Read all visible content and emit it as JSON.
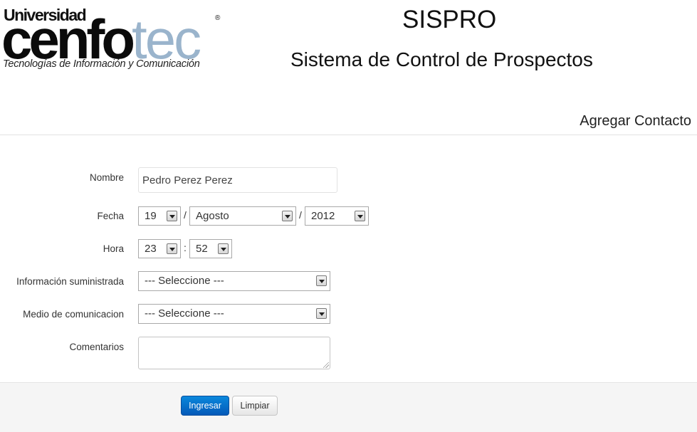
{
  "header": {
    "logo": {
      "top_text": "Universidad",
      "word_part1": "cenfo",
      "word_part2": "tec",
      "registered": "®",
      "tagline": "Tecnologías de Información y Comunicación"
    },
    "app_title": "SISPRO",
    "app_subtitle": "Sistema de Control de Prospectos",
    "section_title": "Agregar Contacto"
  },
  "form": {
    "nombre": {
      "label": "Nombre",
      "value": "Pedro Perez Perez"
    },
    "fecha": {
      "label": "Fecha",
      "day": "19",
      "month": "Agosto",
      "year": "2012",
      "separator": "/"
    },
    "hora": {
      "label": "Hora",
      "hour": "23",
      "minute": "52",
      "separator": ":"
    },
    "informacion": {
      "label": "Información suministrada",
      "selected": "--- Seleccione ---"
    },
    "medio": {
      "label": "Medio de comunicacion",
      "selected": "--- Seleccione ---"
    },
    "comentarios": {
      "label": "Comentarios",
      "value": ""
    }
  },
  "actions": {
    "submit_label": "Ingresar",
    "clear_label": "Limpiar"
  },
  "colors": {
    "primary_button": "#0668c8",
    "logo_tec": "#9ab4cc",
    "footer_bg": "#f5f5f5"
  },
  "icons": [
    "dropdown-arrow-icon",
    "resize-grip-icon"
  ]
}
